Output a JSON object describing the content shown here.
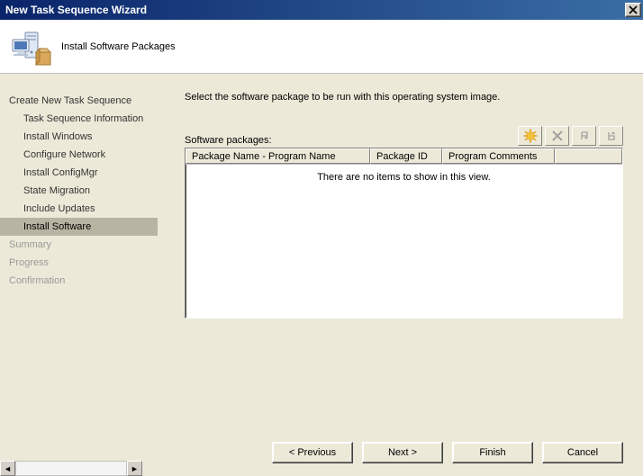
{
  "window": {
    "title": "New Task Sequence Wizard"
  },
  "header": {
    "title": "Install Software Packages"
  },
  "sidebar": {
    "root": "Create New Task Sequence",
    "items": [
      {
        "label": "Task Sequence Information"
      },
      {
        "label": "Install Windows"
      },
      {
        "label": "Configure Network"
      },
      {
        "label": "Install ConfigMgr"
      },
      {
        "label": "State Migration"
      },
      {
        "label": "Include Updates"
      },
      {
        "label": "Install Software"
      }
    ],
    "summary": "Summary",
    "progress": "Progress",
    "confirmation": "Confirmation"
  },
  "main": {
    "instruction": "Select the software package to be run with this operating system image.",
    "packages_label": "Software packages:",
    "col1": "Package Name - Program Name",
    "col2": "Package ID",
    "col3": "Program Comments",
    "empty": "There are no items to show in this view."
  },
  "buttons": {
    "previous": "< Previous",
    "next": "Next >",
    "finish": "Finish",
    "cancel": "Cancel"
  }
}
